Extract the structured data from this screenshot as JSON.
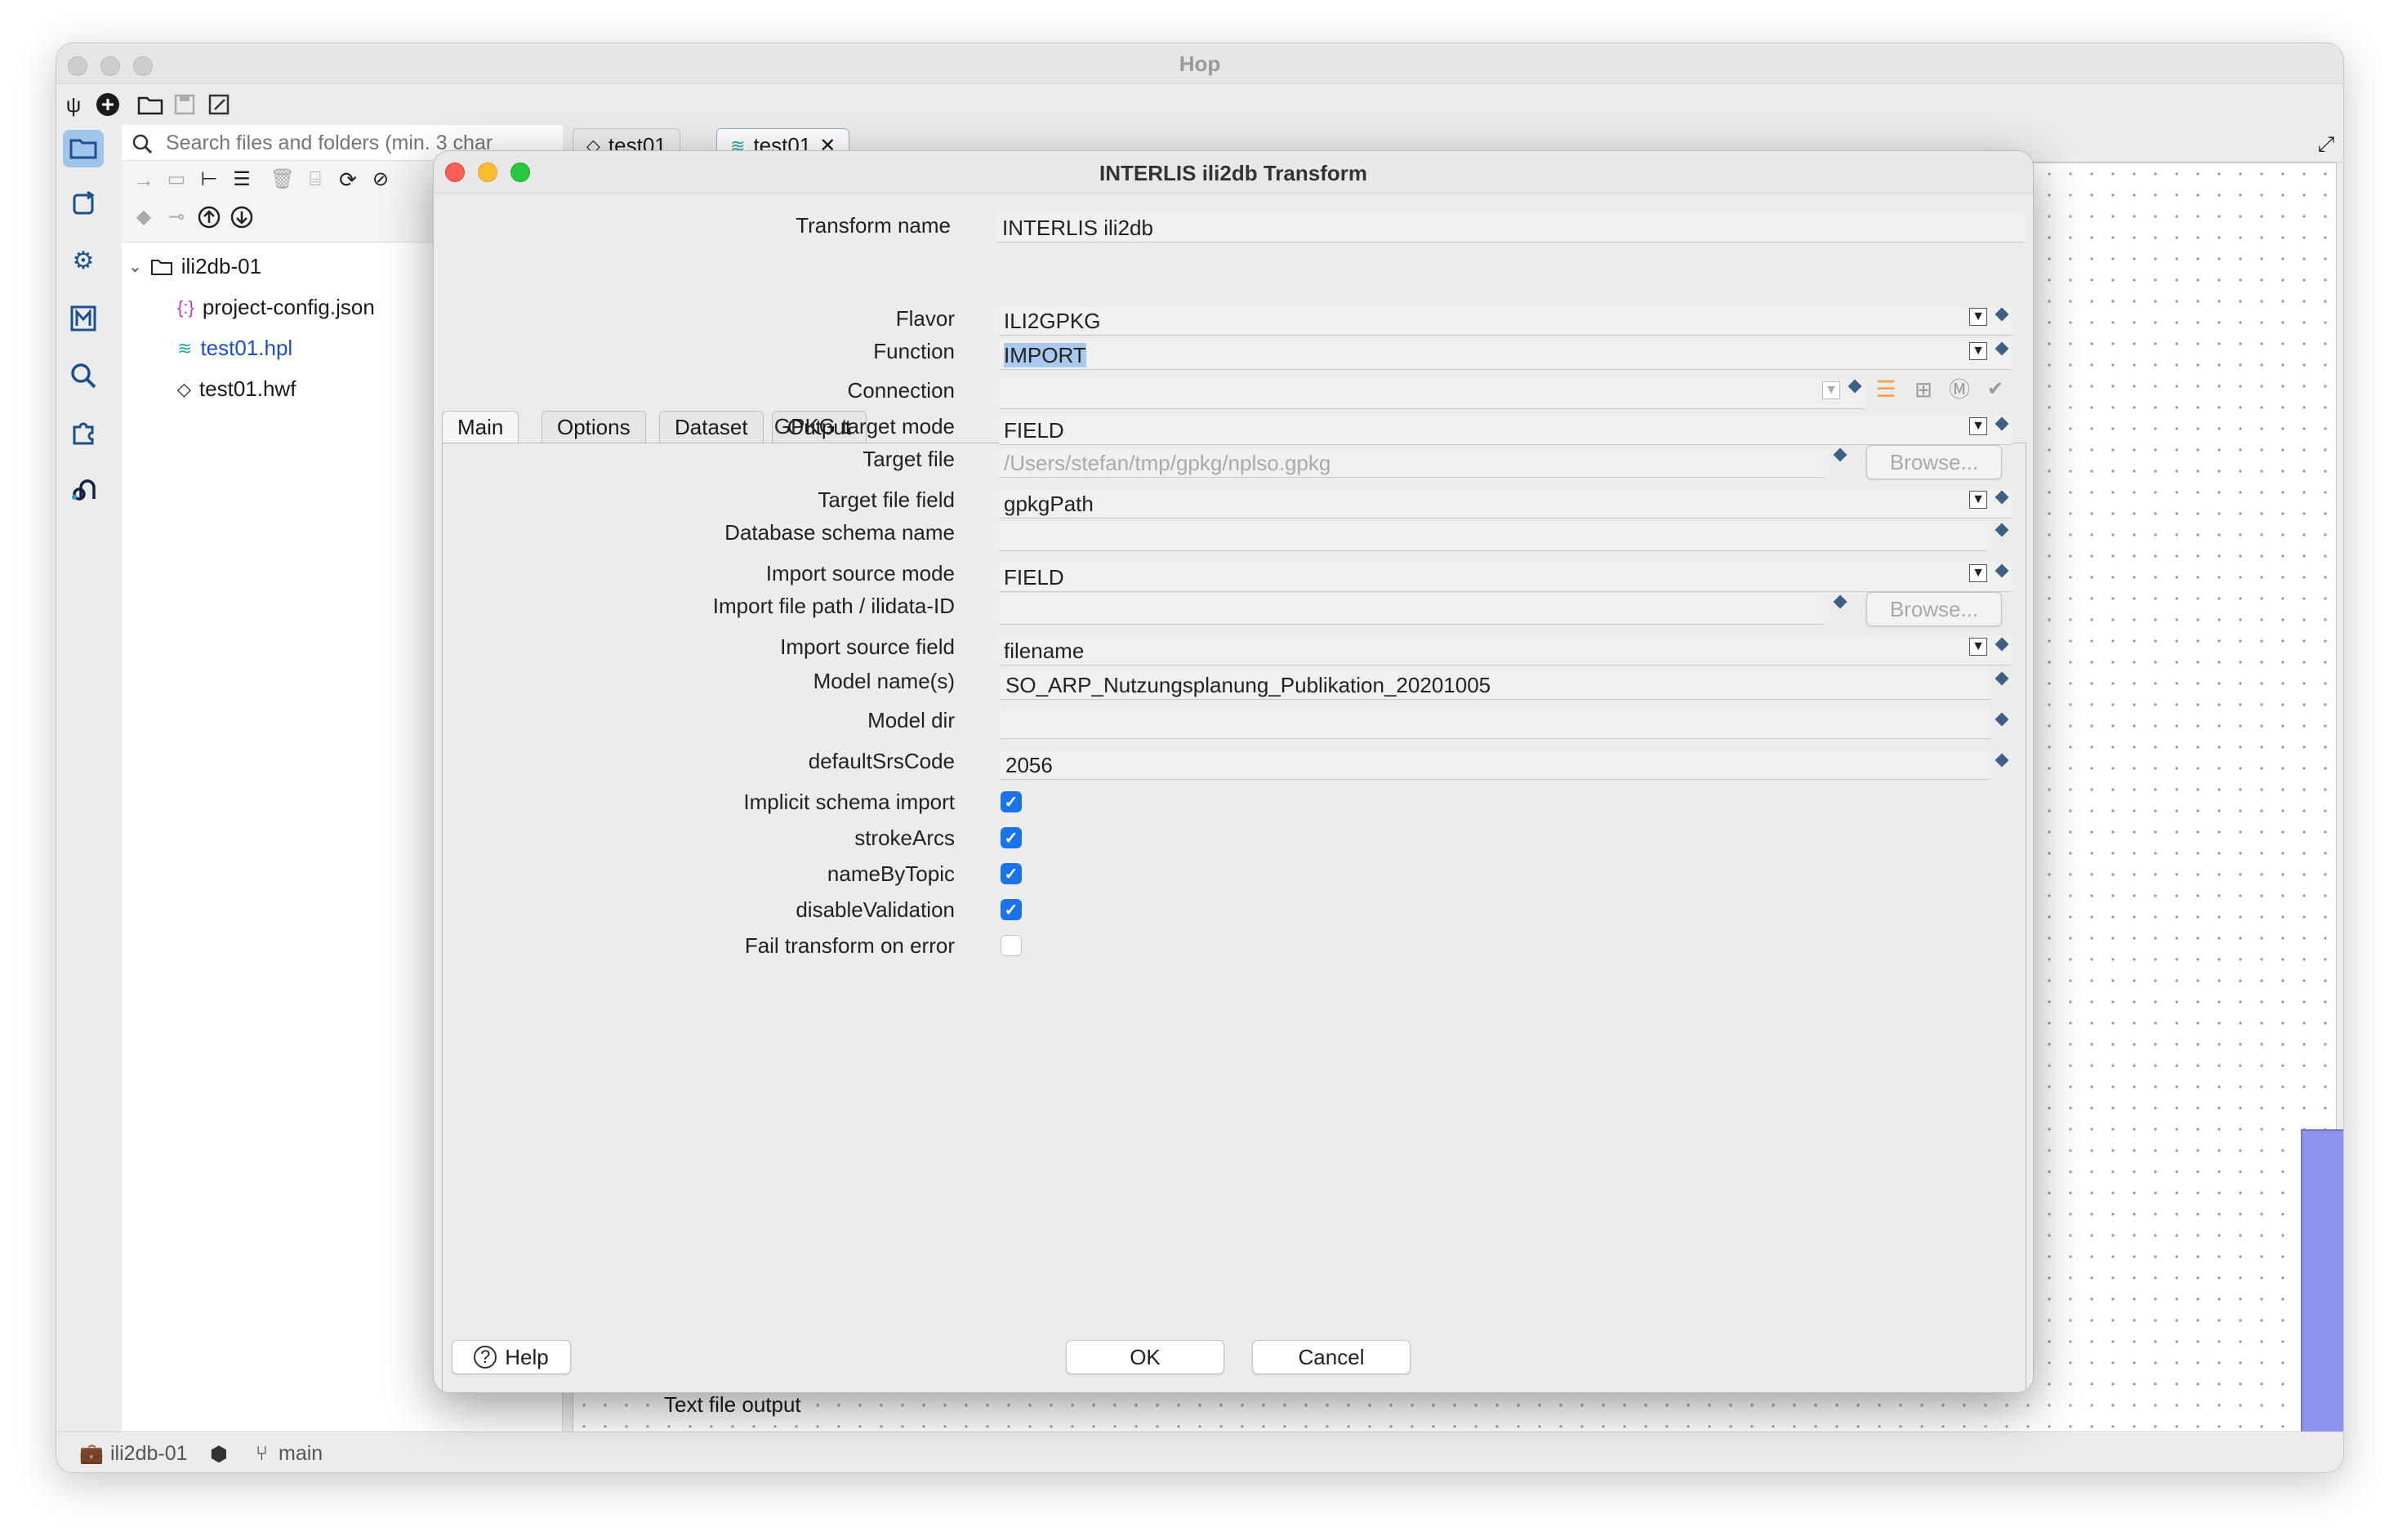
{
  "app": {
    "title": "Hop"
  },
  "search": {
    "placeholder": "Search files and folders (min. 3 char"
  },
  "tree": {
    "root": "ili2db-01",
    "items": [
      "project-config.json",
      "test01.hpl",
      "test01.hwf"
    ]
  },
  "tabs": [
    {
      "label": "test01"
    },
    {
      "label": "test01"
    }
  ],
  "canvas": {
    "transform_label": "Text file output"
  },
  "status": {
    "project": "ili2db-01",
    "branch": "main"
  },
  "dialog": {
    "title": "INTERLIS ili2db Transform",
    "transform_name_label": "Transform name",
    "transform_name_value": "INTERLIS ili2db",
    "tabs": [
      "Main",
      "Options",
      "Dataset",
      "Output"
    ],
    "fields": {
      "flavor": {
        "label": "Flavor",
        "value": "ILI2GPKG"
      },
      "function": {
        "label": "Function",
        "value": "IMPORT"
      },
      "connection": {
        "label": "Connection",
        "value": ""
      },
      "gpkg_target_mode": {
        "label": "GPKG target mode",
        "value": "FIELD"
      },
      "target_file": {
        "label": "Target file",
        "value": "/Users/stefan/tmp/gpkg/nplso.gpkg"
      },
      "target_file_field": {
        "label": "Target file field",
        "value": "gpkgPath"
      },
      "db_schema": {
        "label": "Database schema name",
        "value": ""
      },
      "import_source_mode": {
        "label": "Import source mode",
        "value": "FIELD"
      },
      "import_file_path": {
        "label": "Import file path / ilidata-ID",
        "value": ""
      },
      "import_source_field": {
        "label": "Import source field",
        "value": "filename"
      },
      "model_names": {
        "label": "Model name(s)",
        "value": "SO_ARP_Nutzungsplanung_Publikation_20201005"
      },
      "model_dir": {
        "label": "Model dir",
        "value": ""
      },
      "default_srs": {
        "label": "defaultSrsCode",
        "value": "2056"
      }
    },
    "checkboxes": [
      {
        "label": "Implicit schema import",
        "checked": true
      },
      {
        "label": "strokeArcs",
        "checked": true
      },
      {
        "label": "nameByTopic",
        "checked": true
      },
      {
        "label": "disableValidation",
        "checked": true
      },
      {
        "label": "Fail transform on error",
        "checked": false
      }
    ],
    "browse_label": "Browse...",
    "help_label": "Help",
    "ok_label": "OK",
    "cancel_label": "Cancel"
  }
}
